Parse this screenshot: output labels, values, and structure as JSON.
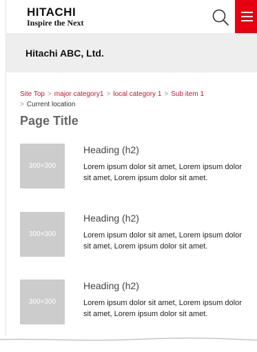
{
  "header": {
    "logo": {
      "word": "HITACHI",
      "tagline": "Inspire the Next"
    }
  },
  "site": {
    "name": "Hitachi ABC, Ltd."
  },
  "breadcrumb": {
    "items": [
      "Site Top",
      "major category1",
      "local category 1",
      "Sub item 1"
    ],
    "separator": ">",
    "current": "Current location"
  },
  "page": {
    "title": "Page Title"
  },
  "cards": [
    {
      "thumb": "300×300",
      "heading": "Heading (h2)",
      "text": "Lorem ipsum dolor sit amet, Lorem ipsum dolor sit amet, Lorem ipsum dolor sit amet."
    },
    {
      "thumb": "300×300",
      "heading": "Heading (h2)",
      "text": "Lorem ipsum dolor sit amet, Lorem ipsum dolor sit amet, Lorem ipsum dolor sit amet."
    },
    {
      "thumb": "300×300",
      "heading": "Heading (h2)",
      "text": "Lorem ipsum dolor sit amet, Lorem ipsum dolor sit amet, Lorem ipsum dolor sit amet."
    }
  ],
  "colors": {
    "accent": "#e60012",
    "link": "#c8102e",
    "site_bar": "#eeeeee",
    "thumb": "#cccccc"
  },
  "icons": {
    "search": "search-icon",
    "menu": "hamburger-menu-icon"
  }
}
